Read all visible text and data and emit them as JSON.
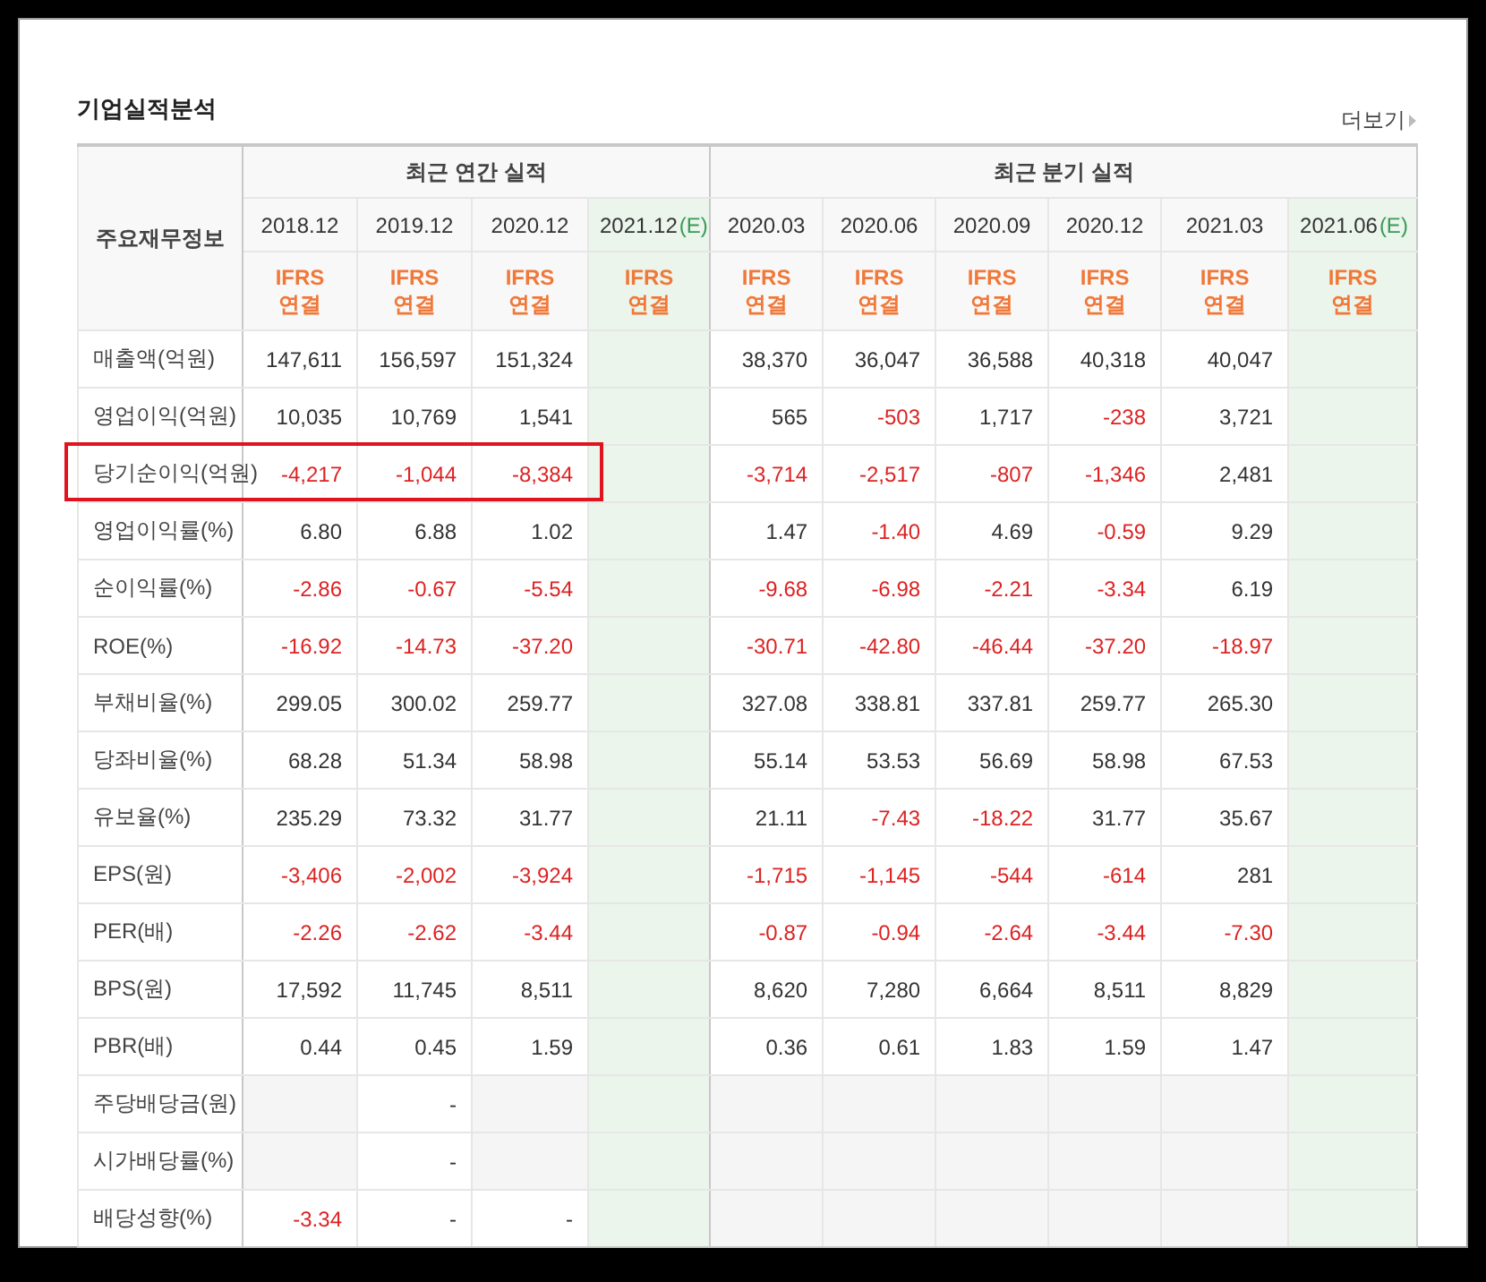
{
  "title": "기업실적분석",
  "more_link": "더보기",
  "header": {
    "label": "주요재무정보",
    "groups": [
      {
        "title": "최근 연간 실적",
        "periods": [
          {
            "date": "2018.12",
            "estimate": false,
            "basis": "IFRS 연결"
          },
          {
            "date": "2019.12",
            "estimate": false,
            "basis": "IFRS 연결"
          },
          {
            "date": "2020.12",
            "estimate": false,
            "basis": "IFRS 연결"
          },
          {
            "date": "2021.12",
            "suffix": "(E)",
            "estimate": true,
            "basis": "IFRS 연결"
          }
        ]
      },
      {
        "title": "최근 분기 실적",
        "periods": [
          {
            "date": "2020.03",
            "estimate": false,
            "basis": "IFRS 연결"
          },
          {
            "date": "2020.06",
            "estimate": false,
            "basis": "IFRS 연결"
          },
          {
            "date": "2020.09",
            "estimate": false,
            "basis": "IFRS 연결"
          },
          {
            "date": "2020.12",
            "estimate": false,
            "basis": "IFRS 연결"
          },
          {
            "date": "2021.03",
            "estimate": false,
            "basis": "IFRS 연결"
          },
          {
            "date": "2021.06",
            "suffix": "(E)",
            "estimate": true,
            "basis": "IFRS 연결"
          }
        ]
      }
    ]
  },
  "sections": [
    {
      "rows": [
        {
          "label": "매출액(억원)",
          "highlighted": false,
          "cells": [
            {
              "value": "147,611",
              "negative": false
            },
            {
              "value": "156,597",
              "negative": false
            },
            {
              "value": "151,324",
              "negative": false
            },
            null,
            {
              "value": "38,370",
              "negative": false
            },
            {
              "value": "36,047",
              "negative": false
            },
            {
              "value": "36,588",
              "negative": false
            },
            {
              "value": "40,318",
              "negative": false
            },
            {
              "value": "40,047",
              "negative": false
            },
            null
          ]
        },
        {
          "label": "영업이익(억원)",
          "highlighted": false,
          "cells": [
            {
              "value": "10,035",
              "negative": false
            },
            {
              "value": "10,769",
              "negative": false
            },
            {
              "value": "1,541",
              "negative": false
            },
            null,
            {
              "value": "565",
              "negative": false
            },
            {
              "value": "-503",
              "negative": true
            },
            {
              "value": "1,717",
              "negative": false
            },
            {
              "value": "-238",
              "negative": true
            },
            {
              "value": "3,721",
              "negative": false
            },
            null
          ]
        },
        {
          "label": "당기순이익(억원)",
          "highlighted": true,
          "cells": [
            {
              "value": "-4,217",
              "negative": true
            },
            {
              "value": "-1,044",
              "negative": true
            },
            {
              "value": "-8,384",
              "negative": true
            },
            null,
            {
              "value": "-3,714",
              "negative": true
            },
            {
              "value": "-2,517",
              "negative": true
            },
            {
              "value": "-807",
              "negative": true
            },
            {
              "value": "-1,346",
              "negative": true
            },
            {
              "value": "2,481",
              "negative": false
            },
            null
          ]
        }
      ]
    },
    {
      "rows": [
        {
          "label": "영업이익률(%)",
          "highlighted": false,
          "cells": [
            {
              "value": "6.80",
              "negative": false
            },
            {
              "value": "6.88",
              "negative": false
            },
            {
              "value": "1.02",
              "negative": false
            },
            null,
            {
              "value": "1.47",
              "negative": false
            },
            {
              "value": "-1.40",
              "negative": true
            },
            {
              "value": "4.69",
              "negative": false
            },
            {
              "value": "-0.59",
              "negative": true
            },
            {
              "value": "9.29",
              "negative": false
            },
            null
          ]
        },
        {
          "label": "순이익률(%)",
          "highlighted": false,
          "cells": [
            {
              "value": "-2.86",
              "negative": true
            },
            {
              "value": "-0.67",
              "negative": true
            },
            {
              "value": "-5.54",
              "negative": true
            },
            null,
            {
              "value": "-9.68",
              "negative": true
            },
            {
              "value": "-6.98",
              "negative": true
            },
            {
              "value": "-2.21",
              "negative": true
            },
            {
              "value": "-3.34",
              "negative": true
            },
            {
              "value": "6.19",
              "negative": false
            },
            null
          ]
        },
        {
          "label": "ROE(%)",
          "highlighted": false,
          "cells": [
            {
              "value": "-16.92",
              "negative": true
            },
            {
              "value": "-14.73",
              "negative": true
            },
            {
              "value": "-37.20",
              "negative": true
            },
            null,
            {
              "value": "-30.71",
              "negative": true
            },
            {
              "value": "-42.80",
              "negative": true
            },
            {
              "value": "-46.44",
              "negative": true
            },
            {
              "value": "-37.20",
              "negative": true
            },
            {
              "value": "-18.97",
              "negative": true
            },
            null
          ]
        }
      ]
    },
    {
      "rows": [
        {
          "label": "부채비율(%)",
          "highlighted": false,
          "cells": [
            {
              "value": "299.05",
              "negative": false
            },
            {
              "value": "300.02",
              "negative": false
            },
            {
              "value": "259.77",
              "negative": false
            },
            null,
            {
              "value": "327.08",
              "negative": false
            },
            {
              "value": "338.81",
              "negative": false
            },
            {
              "value": "337.81",
              "negative": false
            },
            {
              "value": "259.77",
              "negative": false
            },
            {
              "value": "265.30",
              "negative": false
            },
            null
          ]
        },
        {
          "label": "당좌비율(%)",
          "highlighted": false,
          "cells": [
            {
              "value": "68.28",
              "negative": false
            },
            {
              "value": "51.34",
              "negative": false
            },
            {
              "value": "58.98",
              "negative": false
            },
            null,
            {
              "value": "55.14",
              "negative": false
            },
            {
              "value": "53.53",
              "negative": false
            },
            {
              "value": "56.69",
              "negative": false
            },
            {
              "value": "58.98",
              "negative": false
            },
            {
              "value": "67.53",
              "negative": false
            },
            null
          ]
        },
        {
          "label": "유보율(%)",
          "highlighted": false,
          "cells": [
            {
              "value": "235.29",
              "negative": false
            },
            {
              "value": "73.32",
              "negative": false
            },
            {
              "value": "31.77",
              "negative": false
            },
            null,
            {
              "value": "21.11",
              "negative": false
            },
            {
              "value": "-7.43",
              "negative": true
            },
            {
              "value": "-18.22",
              "negative": true
            },
            {
              "value": "31.77",
              "negative": false
            },
            {
              "value": "35.67",
              "negative": false
            },
            null
          ]
        }
      ]
    },
    {
      "rows": [
        {
          "label": "EPS(원)",
          "highlighted": false,
          "cells": [
            {
              "value": "-3,406",
              "negative": true
            },
            {
              "value": "-2,002",
              "negative": true
            },
            {
              "value": "-3,924",
              "negative": true
            },
            null,
            {
              "value": "-1,715",
              "negative": true
            },
            {
              "value": "-1,145",
              "negative": true
            },
            {
              "value": "-544",
              "negative": true
            },
            {
              "value": "-614",
              "negative": true
            },
            {
              "value": "281",
              "negative": false
            },
            null
          ]
        },
        {
          "label": "PER(배)",
          "highlighted": false,
          "cells": [
            {
              "value": "-2.26",
              "negative": true
            },
            {
              "value": "-2.62",
              "negative": true
            },
            {
              "value": "-3.44",
              "negative": true
            },
            null,
            {
              "value": "-0.87",
              "negative": true
            },
            {
              "value": "-0.94",
              "negative": true
            },
            {
              "value": "-2.64",
              "negative": true
            },
            {
              "value": "-3.44",
              "negative": true
            },
            {
              "value": "-7.30",
              "negative": true
            },
            null
          ]
        },
        {
          "label": "BPS(원)",
          "highlighted": false,
          "cells": [
            {
              "value": "17,592",
              "negative": false
            },
            {
              "value": "11,745",
              "negative": false
            },
            {
              "value": "8,511",
              "negative": false
            },
            null,
            {
              "value": "8,620",
              "negative": false
            },
            {
              "value": "7,280",
              "negative": false
            },
            {
              "value": "6,664",
              "negative": false
            },
            {
              "value": "8,511",
              "negative": false
            },
            {
              "value": "8,829",
              "negative": false
            },
            null
          ]
        },
        {
          "label": "PBR(배)",
          "highlighted": false,
          "cells": [
            {
              "value": "0.44",
              "negative": false
            },
            {
              "value": "0.45",
              "negative": false
            },
            {
              "value": "1.59",
              "negative": false
            },
            null,
            {
              "value": "0.36",
              "negative": false
            },
            {
              "value": "0.61",
              "negative": false
            },
            {
              "value": "1.83",
              "negative": false
            },
            {
              "value": "1.59",
              "negative": false
            },
            {
              "value": "1.47",
              "negative": false
            },
            null
          ]
        }
      ]
    },
    {
      "rows": [
        {
          "label": "주당배당금(원)",
          "highlighted": false,
          "cells": [
            null,
            {
              "value": "-",
              "negative": false
            },
            null,
            null,
            null,
            null,
            null,
            null,
            null,
            null
          ]
        },
        {
          "label": "시가배당률(%)",
          "highlighted": false,
          "cells": [
            null,
            {
              "value": "-",
              "negative": false
            },
            null,
            null,
            null,
            null,
            null,
            null,
            null,
            null
          ]
        },
        {
          "label": "배당성향(%)",
          "highlighted": false,
          "cells": [
            {
              "value": "-3.34",
              "negative": true
            },
            {
              "value": "-",
              "negative": false
            },
            {
              "value": "-",
              "negative": false
            },
            null,
            null,
            null,
            null,
            null,
            null,
            null
          ]
        }
      ]
    }
  ]
}
